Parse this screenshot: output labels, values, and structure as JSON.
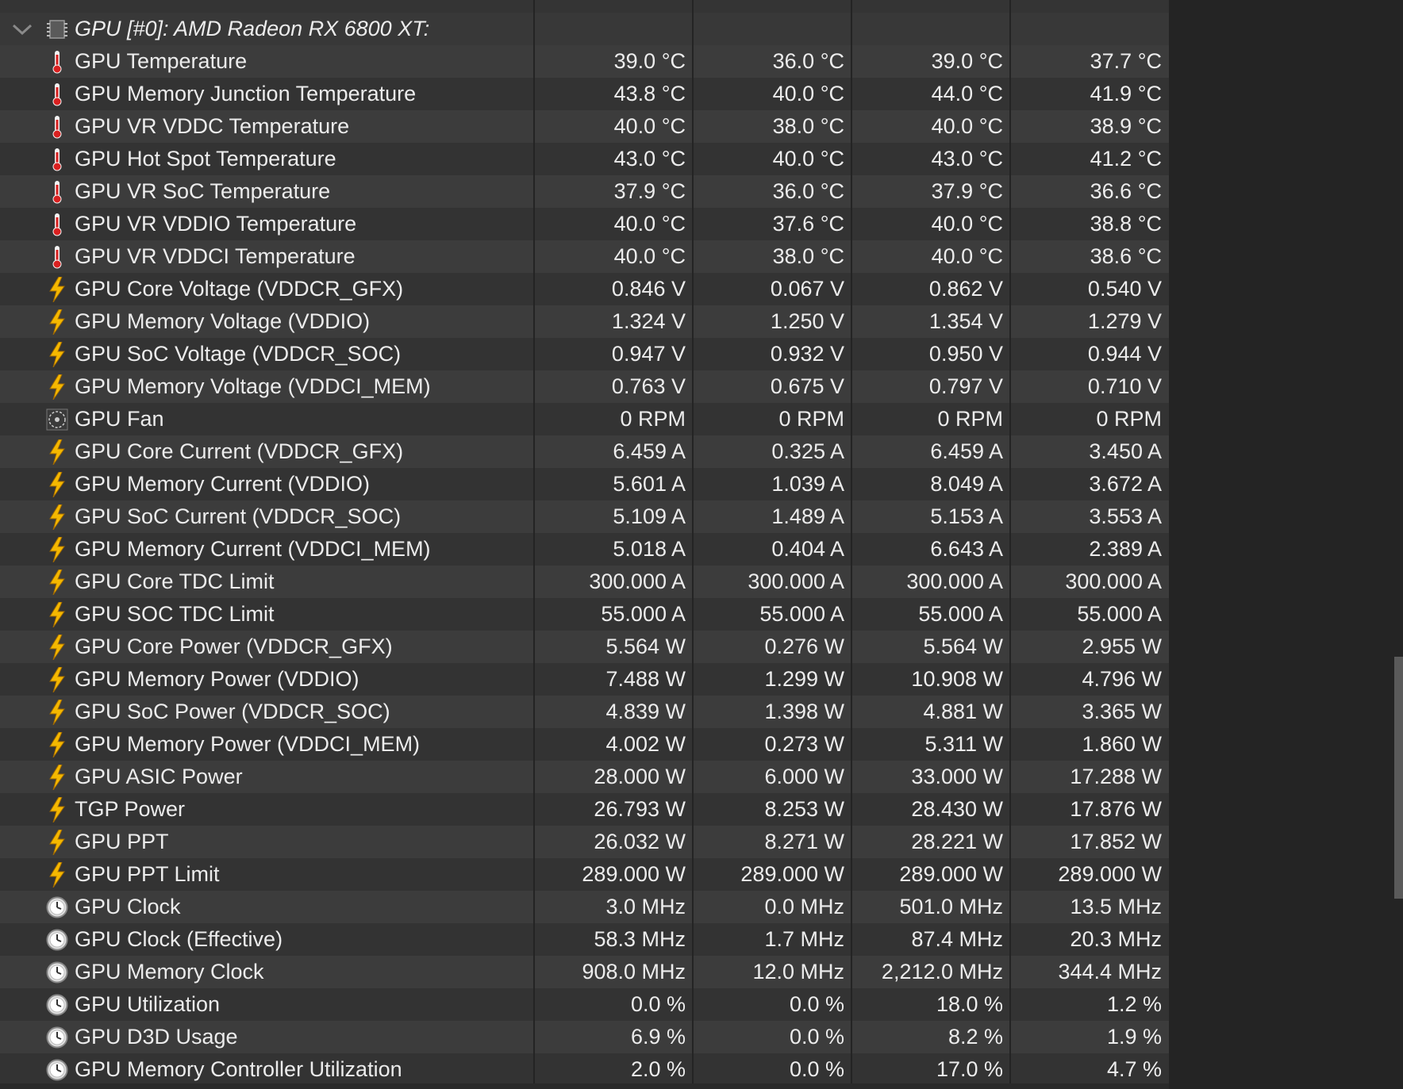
{
  "group": {
    "label": "GPU [#0]: AMD Radeon RX 6800 XT:",
    "expander_icon": "chevron-down-icon",
    "icon": "gpu-chip-icon"
  },
  "icon_colors": {
    "thermometer": "#d92020",
    "lightning": "#f5b800",
    "fan": "#cccccc",
    "clock": "#e0e0e0"
  },
  "rows": [
    {
      "label": "GPU Temperature",
      "icon": "thermometer-icon",
      "values": [
        "39.0 °C",
        "36.0 °C",
        "39.0 °C",
        "37.7 °C"
      ]
    },
    {
      "label": "GPU Memory Junction Temperature",
      "icon": "thermometer-icon",
      "values": [
        "43.8 °C",
        "40.0 °C",
        "44.0 °C",
        "41.9 °C"
      ]
    },
    {
      "label": "GPU VR VDDC Temperature",
      "icon": "thermometer-icon",
      "values": [
        "40.0 °C",
        "38.0 °C",
        "40.0 °C",
        "38.9 °C"
      ]
    },
    {
      "label": "GPU Hot Spot Temperature",
      "icon": "thermometer-icon",
      "values": [
        "43.0 °C",
        "40.0 °C",
        "43.0 °C",
        "41.2 °C"
      ]
    },
    {
      "label": "GPU VR SoC Temperature",
      "icon": "thermometer-icon",
      "values": [
        "37.9 °C",
        "36.0 °C",
        "37.9 °C",
        "36.6 °C"
      ]
    },
    {
      "label": "GPU VR VDDIO Temperature",
      "icon": "thermometer-icon",
      "values": [
        "40.0 °C",
        "37.6 °C",
        "40.0 °C",
        "38.8 °C"
      ]
    },
    {
      "label": "GPU VR VDDCI Temperature",
      "icon": "thermometer-icon",
      "values": [
        "40.0 °C",
        "38.0 °C",
        "40.0 °C",
        "38.6 °C"
      ]
    },
    {
      "label": "GPU Core Voltage (VDDCR_GFX)",
      "icon": "lightning-icon",
      "values": [
        "0.846 V",
        "0.067 V",
        "0.862 V",
        "0.540 V"
      ]
    },
    {
      "label": "GPU Memory Voltage (VDDIO)",
      "icon": "lightning-icon",
      "values": [
        "1.324 V",
        "1.250 V",
        "1.354 V",
        "1.279 V"
      ]
    },
    {
      "label": "GPU SoC Voltage (VDDCR_SOC)",
      "icon": "lightning-icon",
      "values": [
        "0.947 V",
        "0.932 V",
        "0.950 V",
        "0.944 V"
      ]
    },
    {
      "label": "GPU Memory Voltage (VDDCI_MEM)",
      "icon": "lightning-icon",
      "values": [
        "0.763 V",
        "0.675 V",
        "0.797 V",
        "0.710 V"
      ]
    },
    {
      "label": "GPU Fan",
      "icon": "fan-icon",
      "values": [
        "0 RPM",
        "0 RPM",
        "0 RPM",
        "0 RPM"
      ]
    },
    {
      "label": "GPU Core Current (VDDCR_GFX)",
      "icon": "lightning-icon",
      "values": [
        "6.459 A",
        "0.325 A",
        "6.459 A",
        "3.450 A"
      ]
    },
    {
      "label": "GPU Memory Current (VDDIO)",
      "icon": "lightning-icon",
      "values": [
        "5.601 A",
        "1.039 A",
        "8.049 A",
        "3.672 A"
      ]
    },
    {
      "label": "GPU SoC Current (VDDCR_SOC)",
      "icon": "lightning-icon",
      "values": [
        "5.109 A",
        "1.489 A",
        "5.153 A",
        "3.553 A"
      ]
    },
    {
      "label": "GPU Memory Current (VDDCI_MEM)",
      "icon": "lightning-icon",
      "values": [
        "5.018 A",
        "0.404 A",
        "6.643 A",
        "2.389 A"
      ]
    },
    {
      "label": "GPU Core TDC Limit",
      "icon": "lightning-icon",
      "values": [
        "300.000 A",
        "300.000 A",
        "300.000 A",
        "300.000 A"
      ]
    },
    {
      "label": "GPU SOC TDC Limit",
      "icon": "lightning-icon",
      "values": [
        "55.000 A",
        "55.000 A",
        "55.000 A",
        "55.000 A"
      ]
    },
    {
      "label": "GPU Core Power (VDDCR_GFX)",
      "icon": "lightning-icon",
      "values": [
        "5.564 W",
        "0.276 W",
        "5.564 W",
        "2.955 W"
      ]
    },
    {
      "label": "GPU Memory Power (VDDIO)",
      "icon": "lightning-icon",
      "values": [
        "7.488 W",
        "1.299 W",
        "10.908 W",
        "4.796 W"
      ]
    },
    {
      "label": "GPU SoC Power (VDDCR_SOC)",
      "icon": "lightning-icon",
      "values": [
        "4.839 W",
        "1.398 W",
        "4.881 W",
        "3.365 W"
      ]
    },
    {
      "label": "GPU Memory Power (VDDCI_MEM)",
      "icon": "lightning-icon",
      "values": [
        "4.002 W",
        "0.273 W",
        "5.311 W",
        "1.860 W"
      ]
    },
    {
      "label": "GPU ASIC Power",
      "icon": "lightning-icon",
      "values": [
        "28.000 W",
        "6.000 W",
        "33.000 W",
        "17.288 W"
      ]
    },
    {
      "label": "TGP Power",
      "icon": "lightning-icon",
      "values": [
        "26.793 W",
        "8.253 W",
        "28.430 W",
        "17.876 W"
      ]
    },
    {
      "label": "GPU PPT",
      "icon": "lightning-icon",
      "values": [
        "26.032 W",
        "8.271 W",
        "28.221 W",
        "17.852 W"
      ]
    },
    {
      "label": "GPU PPT Limit",
      "icon": "lightning-icon",
      "values": [
        "289.000 W",
        "289.000 W",
        "289.000 W",
        "289.000 W"
      ]
    },
    {
      "label": "GPU Clock",
      "icon": "clock-icon",
      "values": [
        "3.0 MHz",
        "0.0 MHz",
        "501.0 MHz",
        "13.5 MHz"
      ]
    },
    {
      "label": "GPU Clock (Effective)",
      "icon": "clock-icon",
      "values": [
        "58.3 MHz",
        "1.7 MHz",
        "87.4 MHz",
        "20.3 MHz"
      ]
    },
    {
      "label": "GPU Memory Clock",
      "icon": "clock-icon",
      "values": [
        "908.0 MHz",
        "12.0 MHz",
        "2,212.0 MHz",
        "344.4 MHz"
      ]
    },
    {
      "label": "GPU Utilization",
      "icon": "clock-icon",
      "values": [
        "0.0 %",
        "0.0 %",
        "18.0 %",
        "1.2 %"
      ]
    },
    {
      "label": "GPU D3D Usage",
      "icon": "clock-icon",
      "values": [
        "6.9 %",
        "0.0 %",
        "8.2 %",
        "1.9 %"
      ]
    },
    {
      "label": "GPU Memory Controller Utilization",
      "icon": "clock-icon",
      "values": [
        "2.0 %",
        "0.0 %",
        "17.0 %",
        "4.7 %"
      ]
    }
  ]
}
